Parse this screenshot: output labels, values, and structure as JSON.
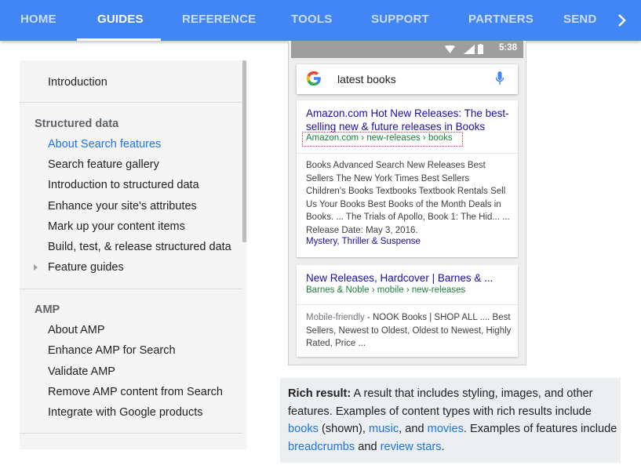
{
  "nav": {
    "tabs": [
      {
        "label": "HOME",
        "active": false
      },
      {
        "label": "GUIDES",
        "active": true
      },
      {
        "label": "REFERENCE",
        "active": false
      },
      {
        "label": "TOOLS",
        "active": false
      },
      {
        "label": "SUPPORT",
        "active": false
      },
      {
        "label": "PARTNERS",
        "active": false
      },
      {
        "label": "SEND",
        "active": false
      }
    ],
    "more_icon": "chevron-right-icon",
    "bg_color": "#4285f4"
  },
  "sidebar": {
    "intro": "Introduction",
    "structured_heading": "Structured data",
    "structured_items": [
      {
        "label": "About Search features",
        "active": true
      },
      {
        "label": "Search feature gallery",
        "active": false
      },
      {
        "label": "Introduction to structured data",
        "active": false
      },
      {
        "label": "Enhance your site's attributes",
        "active": false
      },
      {
        "label": "Mark up your content items",
        "active": false
      },
      {
        "label": "Build, test, & release structured data",
        "active": false
      },
      {
        "label": "Feature guides",
        "active": false,
        "expandable": true
      }
    ],
    "amp_heading": "AMP",
    "amp_items": [
      "About AMP",
      "Enhance AMP for Search",
      "Validate AMP",
      "Remove AMP content from Search",
      "Integrate with Google products"
    ],
    "accent_color": "#1a73e8"
  },
  "phone": {
    "time": "5:38",
    "status_icons": "▼ ⁴ᴳ◢ ▮",
    "search_query": "latest books",
    "results": [
      {
        "title": "Amazon.com Hot New Releases: The best-selling new & future releases in Books",
        "url": "Amazon.com › new-releases › books",
        "snippet": "Books Advanced Search New Releases Best Sellers The New York Times Best Sellers Children's Books Textbooks Textbook Rentals Sell Us Your Books Best Books of the Month Deals in Books. ... The Trials of Apollo, Book 1: The Hid... ... Release Date: May 3, 2016.",
        "sitelinks": "Mystery, Thriller & Suspense"
      },
      {
        "title": "New Releases, Hardcover | Barnes & ...",
        "url": "Barnes & Noble › mobile › new-releases",
        "mobile_friendly": "Mobile-friendly",
        "snippet": " - NOOK Books | SHOP ALL .... Best Sellers, Newest to Oldest, Oldest to Newest, Highly Rated, Price ..."
      }
    ]
  },
  "caption": {
    "label": "Rich result:",
    "text1": " A result that includes styling, images, and other features. Examples of content types with rich results include ",
    "link_books": "books",
    "text2": " (shown), ",
    "link_music": "music",
    "text3": ", and ",
    "link_movies": "movies",
    "text4": ". Examples of features include ",
    "link_breadcrumbs": "breadcrumbs",
    "text5": " and ",
    "link_review": "review stars",
    "text6": "."
  }
}
